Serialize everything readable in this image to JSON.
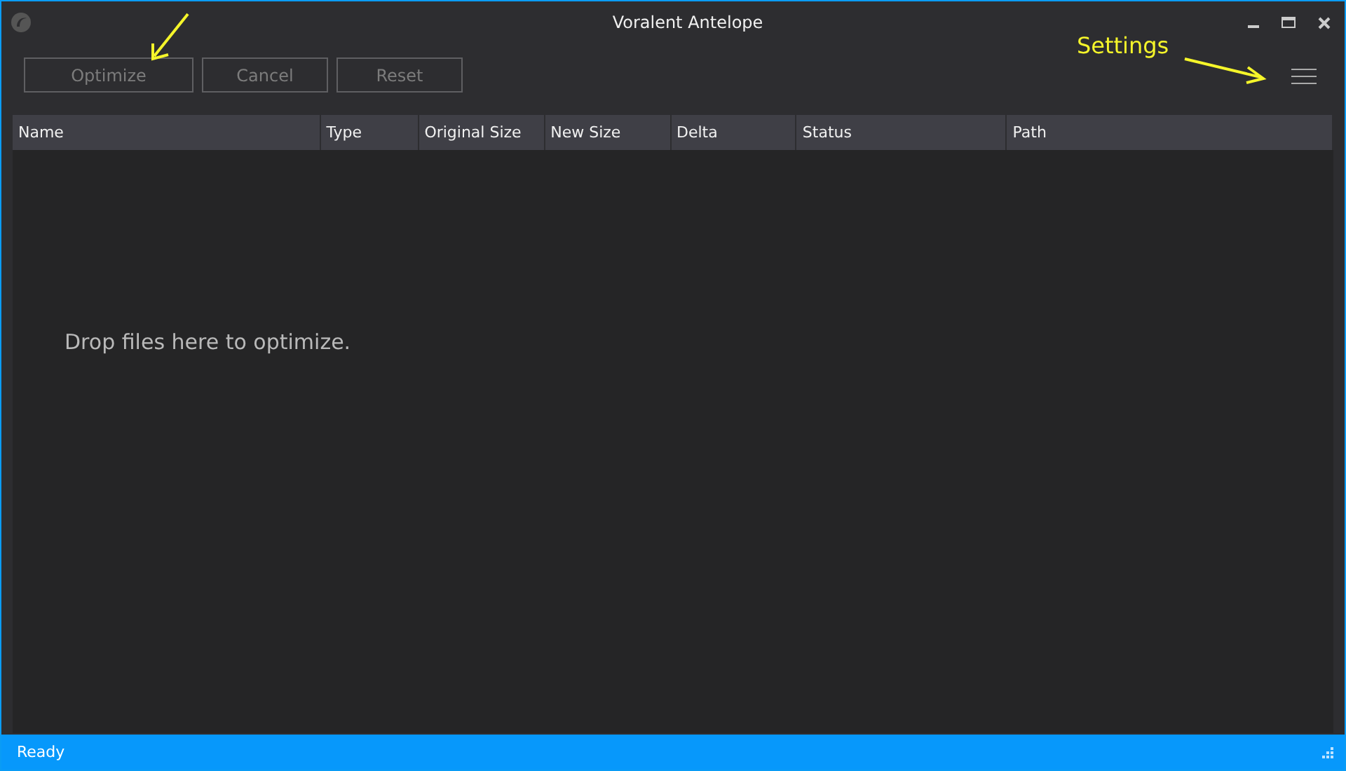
{
  "window": {
    "title": "Voralent Antelope"
  },
  "toolbar": {
    "buttons": [
      {
        "label": "Optimize",
        "disabled": true
      },
      {
        "label": "Cancel",
        "disabled": true
      },
      {
        "label": "Reset",
        "disabled": true
      }
    ]
  },
  "annotations": [
    {
      "kind": "arrow-only"
    },
    {
      "kind": "labelled",
      "label": "Settings"
    }
  ],
  "table": {
    "columns": [
      "Name",
      "Type",
      "Original Size",
      "New Size",
      "Delta",
      "Status",
      "Path"
    ],
    "empty_message": "Drop files here to optimize."
  },
  "status_bar": {
    "text": "Ready"
  }
}
